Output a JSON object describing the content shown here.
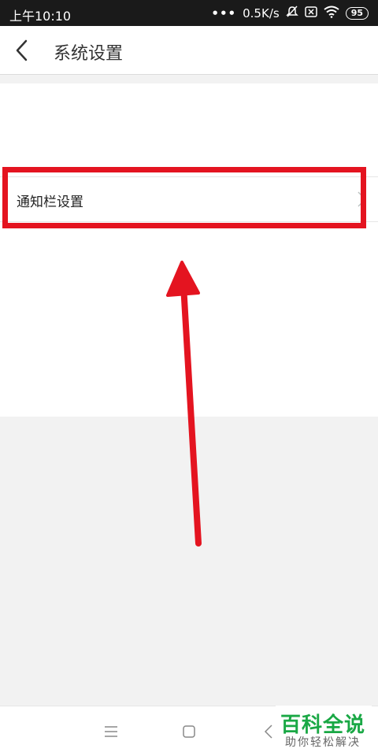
{
  "status_bar": {
    "time": "上午10:10",
    "dots": "•••",
    "net_speed": "0.5K/s",
    "battery": "95"
  },
  "header": {
    "title": "系统设置"
  },
  "settings": {
    "items": [
      {
        "label": "通知栏设置"
      }
    ]
  },
  "watermark": {
    "title": "百科全说",
    "subtitle": "助你轻松解决"
  },
  "colors": {
    "highlight": "#e41420",
    "brand_green": "#1aa845"
  },
  "icons": {
    "back": "chevron-left-icon",
    "row": "chevron-right-icon",
    "nav": [
      "menu-icon",
      "home-square-icon",
      "back-triangle-icon"
    ],
    "status": [
      "mute-icon",
      "sim-off-icon",
      "wifi-icon",
      "battery-icon"
    ]
  }
}
